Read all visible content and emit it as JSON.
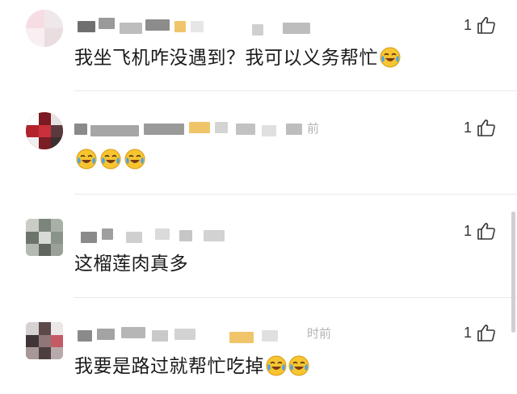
{
  "comments": [
    {
      "text": "我坐飞机咋没遇到？我可以义务帮忙",
      "likes": "1",
      "emoji_count": 1,
      "emoji": "laugh-cry-emoji",
      "timestamp_fragment": ""
    },
    {
      "text": "",
      "likes": "1",
      "emoji_count": 3,
      "emoji": "laugh-cry-emoji",
      "timestamp_fragment": "前"
    },
    {
      "text": "这榴莲肉真多",
      "likes": "1",
      "emoji_count": 0,
      "emoji": "",
      "timestamp_fragment": ""
    },
    {
      "text": "我要是路过就帮忙吃掉",
      "likes": "1",
      "emoji_count": 2,
      "emoji": "laugh-cry-emoji",
      "timestamp_fragment": "时前"
    }
  ],
  "icons": {
    "like": "thumbs-up-icon",
    "emoji": "laugh-cry-emoji"
  },
  "colors": {
    "text": "#1a1a1a",
    "like_count": "#333333",
    "divider": "#e9e9e9",
    "timestamp": "#b3b3b3",
    "emoji_face": "#f7c531",
    "emoji_tears": "#4aa3e8"
  }
}
